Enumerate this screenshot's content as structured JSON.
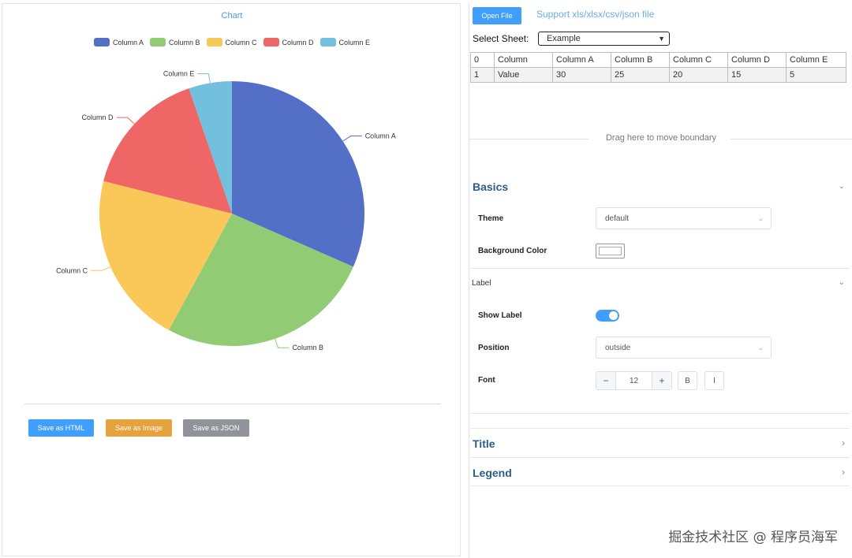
{
  "chart": {
    "title": "Chart",
    "save_html_label": "Save as HTML",
    "save_image_label": "Save as Image",
    "save_json_label": "Save as JSON"
  },
  "chart_data": {
    "type": "pie",
    "title": "Chart",
    "categories": [
      "Column A",
      "Column B",
      "Column C",
      "Column D",
      "Column E"
    ],
    "values": [
      30,
      25,
      20,
      15,
      5
    ],
    "colors": [
      "#5470c6",
      "#91cc75",
      "#fac858",
      "#ee6666",
      "#73c0de"
    ],
    "legend_position": "top-center",
    "label_position": "outside"
  },
  "toolbar": {
    "open_file_label": "Open File",
    "support_text": "Support xls/xlsx/csv/json file",
    "select_sheet_label": "Select Sheet:",
    "sheet_value": "Example"
  },
  "table": {
    "rows": [
      [
        "0",
        "Column",
        "Column A",
        "Column B",
        "Column C",
        "Column D",
        "Column E"
      ],
      [
        "1",
        "Value",
        "30",
        "25",
        "20",
        "15",
        "5"
      ]
    ]
  },
  "drag_text": "Drag here to move boundary",
  "settings": {
    "basics_title": "Basics",
    "theme_label": "Theme",
    "theme_value": "default",
    "bg_color_label": "Background Color",
    "bg_color_value": "#ffffff",
    "label_section": "Label",
    "show_label_label": "Show Label",
    "show_label_on": true,
    "position_label": "Position",
    "position_value": "outside",
    "font_label": "Font",
    "font_size": "12",
    "bold_label": "B",
    "italic_label": "I",
    "title_section": "Title",
    "legend_section": "Legend"
  },
  "watermark": "掘金技术社区 @ 程序员海军"
}
